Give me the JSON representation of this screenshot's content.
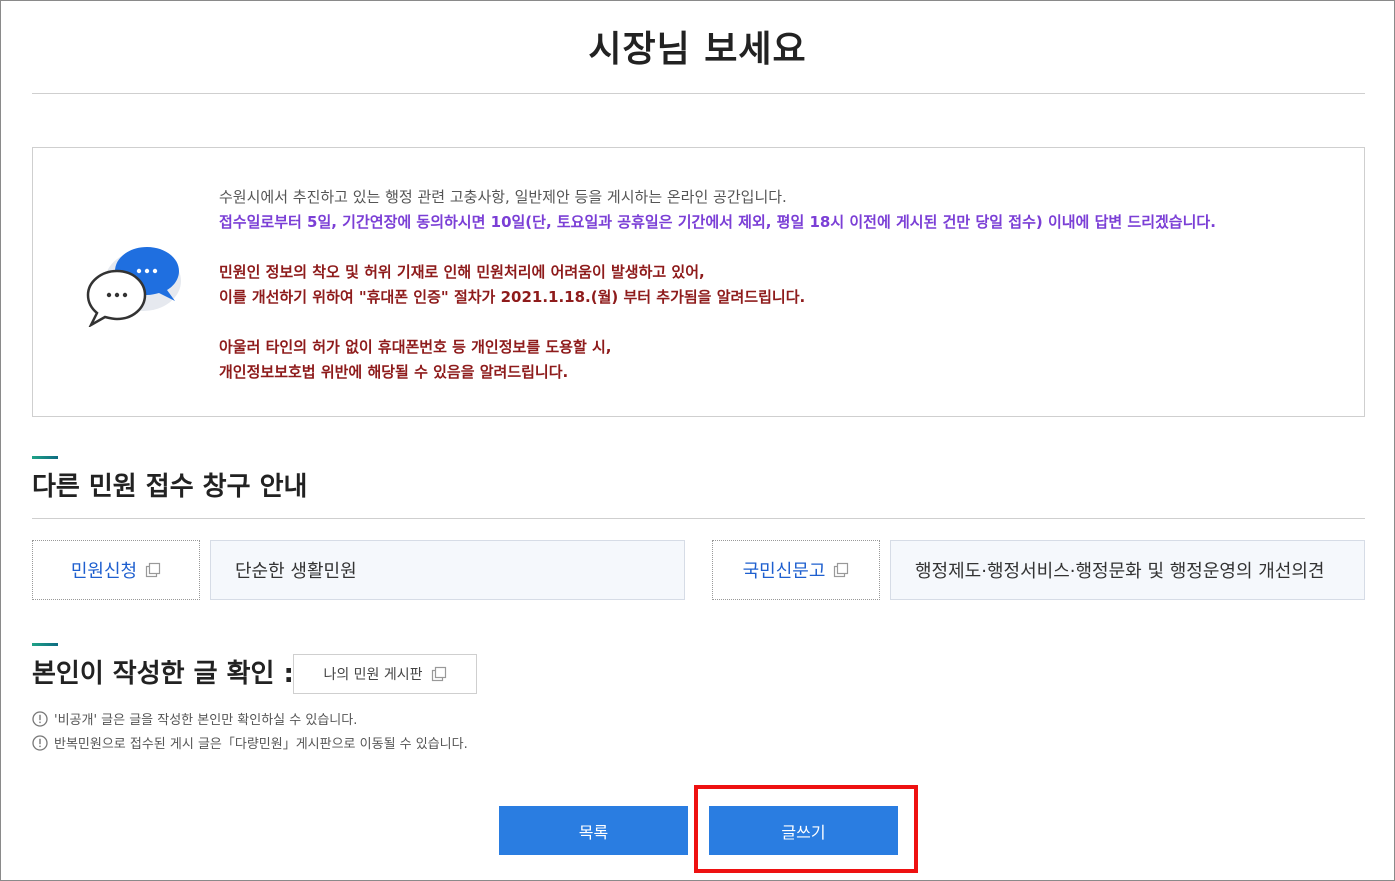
{
  "page": {
    "title": "시장님 보세요"
  },
  "notice": {
    "line1": "수원시에서 추진하고 있는 행정 관련 고충사항, 일반제안 등을 게시하는 온라인 공간입니다.",
    "line2": "접수일로부터 5일, 기간연장에 동의하시면 10일(단, 토요일과 공휴일은 기간에서 제외, 평일 18시 이전에 게시된 건만 당일 접수) 이내에 답변 드리겠습니다.",
    "line3": "민원인 정보의 착오 및 허위 기재로 인해 민원처리에 어려움이 발생하고 있어,",
    "line4": "이를 개선하기 위하여 \"휴대폰 인증\" 절차가 2021.1.18.(월) 부터 추가됨을 알려드립니다.",
    "line5": "아울러 타인의 허가 없이 휴대폰번호 등 개인정보를 도용할 시,",
    "line6": "개인정보보호법 위반에 해당될 수 있음을 알려드립니다.",
    "icon": "speech-bubbles-icon"
  },
  "channels": {
    "heading": "다른 민원 접수 창구 안내",
    "items": [
      {
        "label": "민원신청",
        "description": "단순한 생활민원",
        "icon": "external-link-icon"
      },
      {
        "label": "국민신문고",
        "description": "행정제도·행정서비스·행정문화 및 행정운영의 개선의견",
        "icon": "external-link-icon"
      }
    ]
  },
  "mypost": {
    "heading": "본인이 작성한 글 확인 :",
    "button_label": "나의 민원 게시판",
    "icon": "external-link-icon"
  },
  "info": [
    "'비공개' 글은 글을 작성한 본인만 확인하실 수 있습니다.",
    "반복민원으로 접수된 게시 글은「다량민원」게시판으로 이동될 수 있습니다."
  ],
  "buttons": {
    "list_label": "목록",
    "write_label": "글쓰기"
  },
  "colors": {
    "accent": "#2a7de1",
    "purple_text": "#7b3fd6",
    "maroon_text": "#8e1b1b",
    "highlight": "#ee1111",
    "link": "#1e5fcf"
  }
}
